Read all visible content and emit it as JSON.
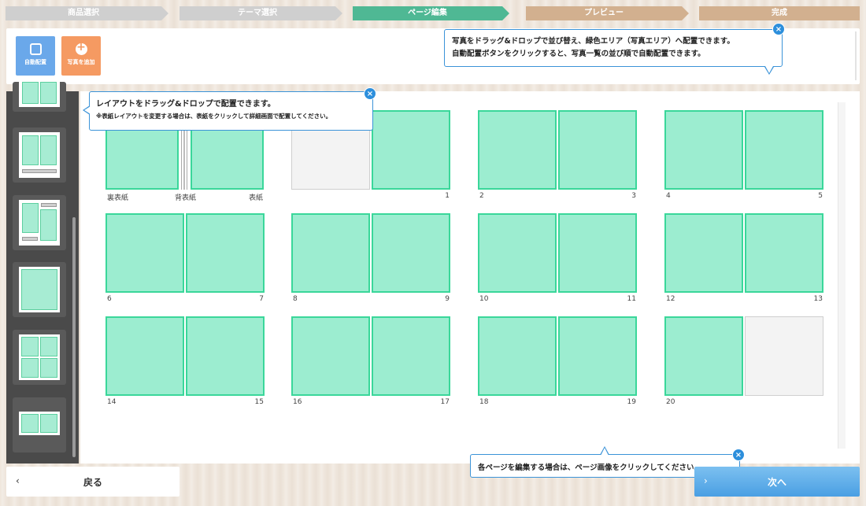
{
  "steps": [
    "商品選択",
    "テーマ選択",
    "ページ編集",
    "プレビュー",
    "完成"
  ],
  "toolbar": {
    "auto_label": "自動配置",
    "add_label": "写真を追加"
  },
  "tips": {
    "top_line1": "写真をドラッグ&ドロップで並び替え、緑色エリア（写真エリア）へ配置できます。",
    "top_line2": "自動配置ボタンをクリックすると、写真一覧の並び順で自動配置できます。",
    "layout_line1": "レイアウトをドラッグ&ドロップで配置できます。",
    "layout_line2": "※表紙レイアウトを変更する場合は、表紙をクリックして詳細画面で配置してください。",
    "bottom_line": "各ページを編集する場合は、ページ画像をクリックしてください。",
    "close": "×"
  },
  "cover": {
    "back": "裏表紙",
    "spine": "背表紙",
    "front": "表紙"
  },
  "pages": [
    "1",
    "2",
    "3",
    "4",
    "5",
    "6",
    "7",
    "8",
    "9",
    "10",
    "11",
    "12",
    "13",
    "14",
    "15",
    "16",
    "17",
    "18",
    "19",
    "20"
  ],
  "nav": {
    "back_label": "戻る",
    "back_chevron": "‹",
    "next_label": "次へ",
    "next_chevron": "›"
  },
  "colors": {
    "active_step": "#4fb894",
    "pending_step": "#d2b08f",
    "done_step": "#cfcfcf",
    "photo_area": "#9cedd0",
    "photo_border": "#3ad79a",
    "accent": "#3b93d8"
  },
  "icons": {
    "auto": "auto-layout-icon",
    "add": "add-photo-icon",
    "close": "close-icon"
  }
}
